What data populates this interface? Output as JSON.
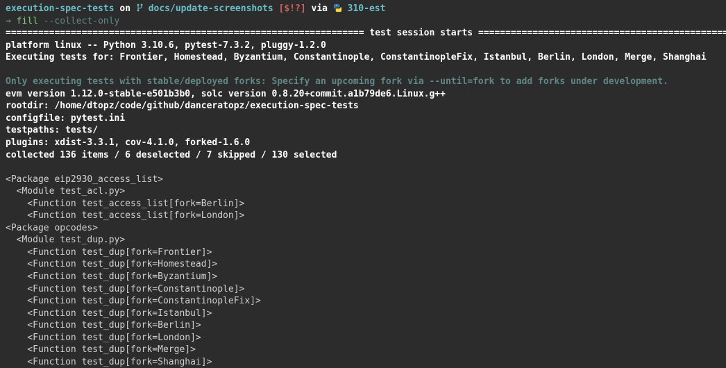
{
  "prompt": {
    "repo": "execution-spec-tests",
    "on": "on",
    "branch": "docs/update-screenshots",
    "git_status": "[$!?]",
    "via": "via",
    "venv": "310-est",
    "arrow": "→",
    "command": "fill",
    "args": "--collect-only"
  },
  "session": {
    "divider_left": "==================================================================",
    "divider_title": " test session starts ",
    "divider_right": "===================================================================",
    "platform": "platform linux -- Python 3.10.6, pytest-7.3.2, pluggy-1.2.0",
    "executing_label": "Executing tests for: ",
    "executing_forks": "Frontier, Homestead, Byzantium, Constantinople, ConstantinopleFix, Istanbul, Berlin, London, Merge, Shanghai",
    "stable_note": "Only executing tests with stable/deployed forks: Specify an upcoming fork via --until=fork to add forks under development.",
    "evm": "evm version 1.12.0-stable-e501b3b0, solc version 0.8.20+commit.a1b79de6.Linux.g++",
    "rootdir": "rootdir: /home/dtopz/code/github/danceratopz/execution-spec-tests",
    "configfile": "configfile: pytest.ini",
    "testpaths": "testpaths: tests/",
    "plugins": "plugins: xdist-3.3.1, cov-4.1.0, forked-1.6.0",
    "collected": "collected 136 items / 6 deselected / 7 skipped / 130 selected"
  },
  "tree": {
    "pkg1": "<Package eip2930_access_list>",
    "pkg1_mod1": "<Module test_acl.py>",
    "pkg1_mod1_funcs": [
      "<Function test_access_list[fork=Berlin]>",
      "<Function test_access_list[fork=London]>"
    ],
    "pkg2": "<Package opcodes>",
    "pkg2_mod1": "<Module test_dup.py>",
    "pkg2_mod1_funcs": [
      "<Function test_dup[fork=Frontier]>",
      "<Function test_dup[fork=Homestead]>",
      "<Function test_dup[fork=Byzantium]>",
      "<Function test_dup[fork=Constantinople]>",
      "<Function test_dup[fork=ConstantinopleFix]>",
      "<Function test_dup[fork=Istanbul]>",
      "<Function test_dup[fork=Berlin]>",
      "<Function test_dup[fork=London]>",
      "<Function test_dup[fork=Merge]>",
      "<Function test_dup[fork=Shanghai]>"
    ]
  }
}
